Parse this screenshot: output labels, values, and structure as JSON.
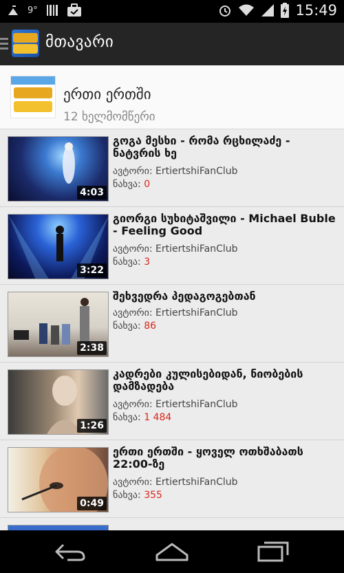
{
  "status_bar": {
    "temperature": "9°",
    "time": "15:49",
    "icons": [
      "signal-icon",
      "temperature-text",
      "barcode-icon",
      "briefcase-icon",
      "alarm-icon",
      "wifi-icon",
      "cell-signal-icon",
      "battery-charging-icon"
    ]
  },
  "action_bar": {
    "title": "მთავარი"
  },
  "channel": {
    "name": "ერთი ერთში",
    "subscribers": "12 ხელმომწერი"
  },
  "labels": {
    "author_prefix": "ავტორი:",
    "views_prefix": "ნახვა:"
  },
  "videos": [
    {
      "title": "გოგა მესხი - რომა რცხილაძე - ნატვრის ხე",
      "author": "ErtiertshiFanClub",
      "views": "0",
      "duration": "4:03"
    },
    {
      "title": "გიორგი სუხიტაშვილი - Michael Buble - Feeling Good",
      "author": "ErtiertshiFanClub",
      "views": "3",
      "duration": "3:22"
    },
    {
      "title": "შეხვედრა პედაგოგებთან",
      "author": "ErtiertshiFanClub",
      "views": "86",
      "duration": "2:38"
    },
    {
      "title": "კადრები კულისებიდან, ნიობების დამზადება",
      "author": "ErtiertshiFanClub",
      "views": "1 484",
      "duration": "1:26"
    },
    {
      "title": "ერთი ერთში - ყოველ ოთხშაბათს 22:00-ზე",
      "author": "ErtiertshiFanClub",
      "views": "355",
      "duration": "0:49"
    }
  ],
  "colors": {
    "action_bar": "#252525",
    "views_accent": "#d8261b",
    "list_bg": "#ececec"
  }
}
